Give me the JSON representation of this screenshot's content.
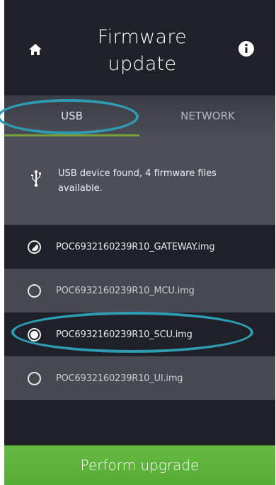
{
  "header": {
    "title_line1": "Firmware",
    "title_line2": "update",
    "home_icon": "home-icon",
    "info_icon": "info-icon"
  },
  "tabs": [
    {
      "label": "USB",
      "active": true
    },
    {
      "label": "NETWORK",
      "active": false
    }
  ],
  "device": {
    "icon": "usb-icon",
    "message": "USB device found, 4 firmware files available."
  },
  "files": [
    {
      "name": "POC6932160239R10_GATEWAY.img",
      "state": "partial"
    },
    {
      "name": "POC6932160239R10_MCU.img",
      "state": "unselected"
    },
    {
      "name": "POC6932160239R10_SCU.img",
      "state": "selected"
    },
    {
      "name": "POC6932160239R10_UI.img",
      "state": "unselected"
    }
  ],
  "action": {
    "upgrade_label": "Perform upgrade"
  },
  "colors": {
    "background": "#1f2128",
    "accent_green": "#5ab33a",
    "highlight": "#2f9bb3",
    "tab_underline": "#7a9e3a"
  }
}
